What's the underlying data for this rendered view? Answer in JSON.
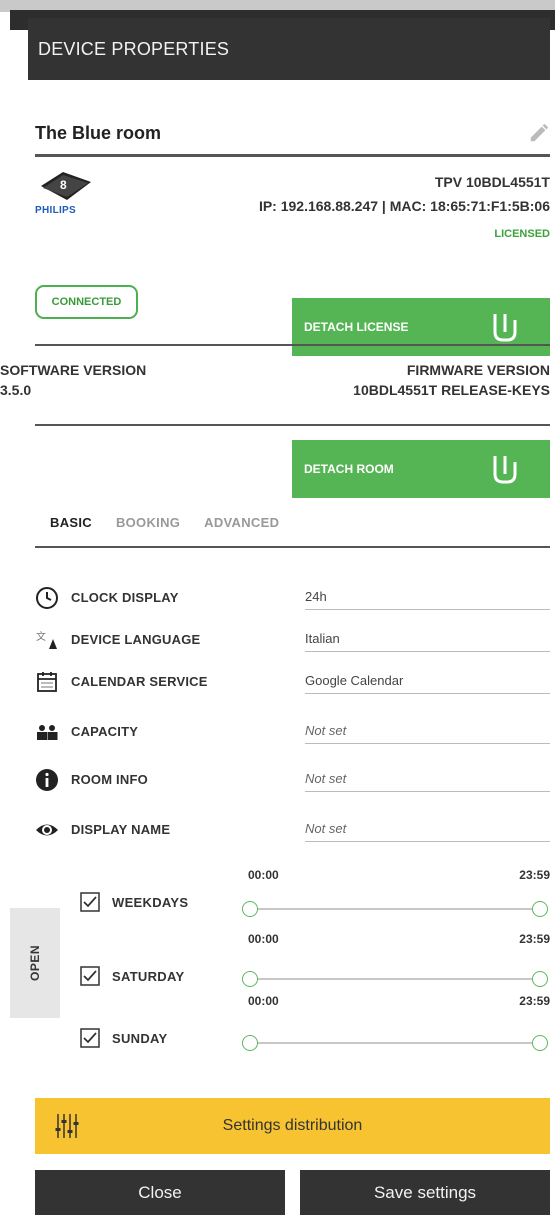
{
  "header": {
    "title": "DEVICE PROPERTIES"
  },
  "room": {
    "name": "The Blue room"
  },
  "device": {
    "logo_badge": "8",
    "brand": "PHILIPS",
    "model": "TPV 10BDL4551T",
    "ip_mac": "IP: 192.168.88.247 | MAC: 18:65:71:F1:5B:06",
    "license_status": "LICENSED",
    "connection_status": "CONNECTED"
  },
  "actions": {
    "detach_license": "DETACH LICENSE",
    "detach_room": "DETACH ROOM"
  },
  "versions": {
    "software_label": "SOFTWARE VERSION",
    "software_value": "3.5.0",
    "firmware_label": "FIRMWARE VERSION",
    "firmware_value": "10BDL4551T RELEASE-KEYS"
  },
  "tabs": [
    {
      "label": "BASIC",
      "active": true
    },
    {
      "label": "BOOKING",
      "active": false
    },
    {
      "label": "ADVANCED",
      "active": false
    }
  ],
  "properties": [
    {
      "label": "CLOCK DISPLAY",
      "value": "24h",
      "icon": "clock-icon"
    },
    {
      "label": "DEVICE LANGUAGE",
      "value": "Italian",
      "icon": "language-icon"
    },
    {
      "label": "CALENDAR SERVICE",
      "value": "Google Calendar",
      "icon": "calendar-icon"
    },
    {
      "label": "CAPACITY",
      "value": "Not set",
      "icon": "people-icon"
    },
    {
      "label": "ROOM INFO",
      "value": "Not set",
      "icon": "info-icon"
    },
    {
      "label": "DISPLAY NAME",
      "value": "Not set",
      "icon": "eye-icon"
    }
  ],
  "open_hours": {
    "label": "OPEN",
    "days": [
      {
        "label": "WEEKDAYS",
        "checked": true,
        "start": "00:00",
        "end": "23:59"
      },
      {
        "label": "SATURDAY",
        "checked": true,
        "start": "00:00",
        "end": "23:59"
      },
      {
        "label": "SUNDAY",
        "checked": true,
        "start": "00:00",
        "end": "23:59"
      }
    ]
  },
  "settings_distribution": {
    "label": "Settings distribution"
  },
  "footer": {
    "close_label": "Close",
    "save_label": "Save settings"
  },
  "colors": {
    "accent_green": "#55b555",
    "warning_yellow": "#f7c331",
    "dark": "#333333"
  }
}
